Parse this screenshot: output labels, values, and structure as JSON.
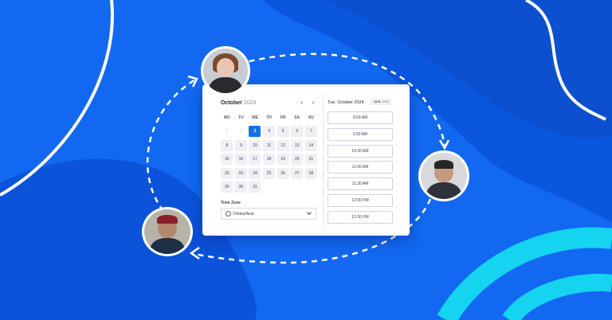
{
  "calendar": {
    "month": "October",
    "year": "2024",
    "prev_icon": "chevron-left-icon",
    "next_icon": "chevron-right-icon",
    "weekdays": [
      "MO",
      "TU",
      "WE",
      "TH",
      "FR",
      "SA",
      "SU"
    ],
    "weeks": [
      [
        "",
        "1",
        "2",
        "3",
        "4",
        "5",
        "6",
        "7"
      ],
      [
        "8",
        "9",
        "10",
        "11",
        "12",
        "13",
        "14"
      ],
      [
        "15",
        "16",
        "17",
        "18",
        "19",
        "20",
        "21"
      ],
      [
        "22",
        "23",
        "24",
        "25",
        "26",
        "27",
        "28"
      ],
      [
        "29",
        "30",
        "31",
        "",
        "",
        "",
        ""
      ]
    ],
    "past_days": [
      "1",
      "2"
    ],
    "selected_day": "3"
  },
  "timezone": {
    "label": "Time Zone",
    "value": "Dhaka/Asia",
    "icon": "globe-icon"
  },
  "slots_panel": {
    "date_heading": "Tue, October 2024",
    "format_options": [
      "12 H",
      "24 H"
    ],
    "active_format": "12 H",
    "times": [
      "9:00 AM",
      "9:30 AM",
      "10:30 AM",
      "11:00 AM",
      "11:30 AM",
      "12:00 PM",
      "12:30 PM"
    ]
  },
  "colors": {
    "background": "#1268f0",
    "accent": "#1273e8",
    "cyan": "#14d4f0"
  }
}
